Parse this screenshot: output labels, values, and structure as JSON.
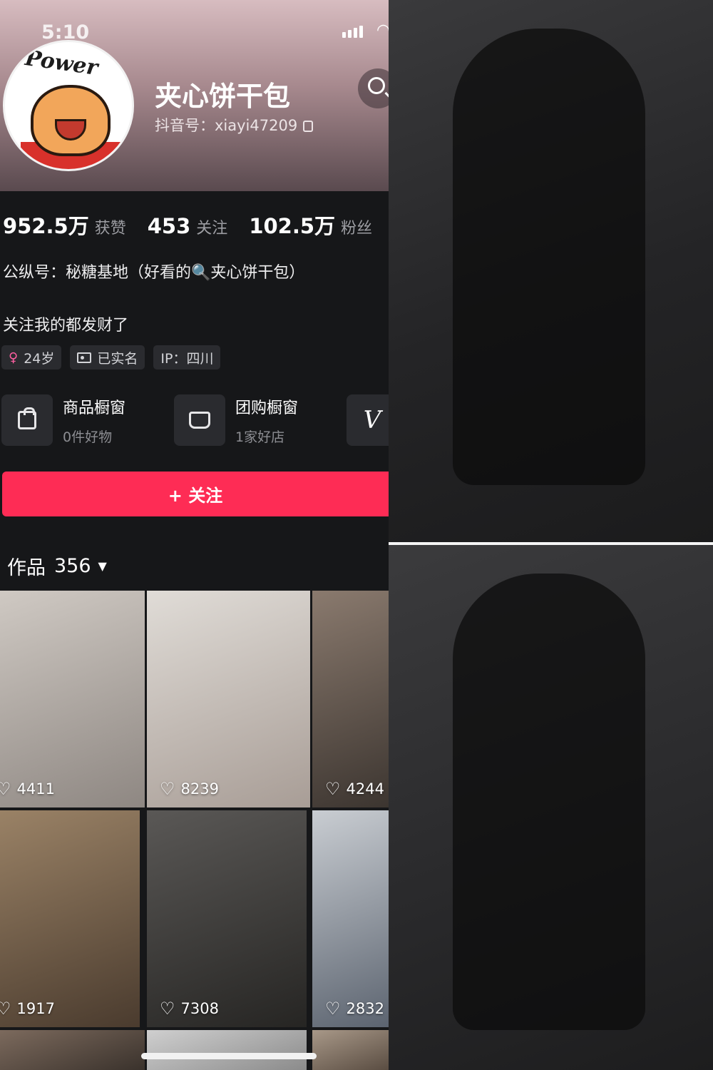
{
  "status_bar": {
    "time": "5:10"
  },
  "profile": {
    "name": "夹心饼干包",
    "douyin_id": "抖音号：xiayi47209",
    "avatar_text": "Power"
  },
  "stats": [
    {
      "value": "952.5万",
      "label": "获赞"
    },
    {
      "value": "453",
      "label": "关注"
    },
    {
      "value": "102.5万",
      "label": "粉丝"
    }
  ],
  "bio": {
    "line1": "公纵号：秘糖基地（好看的🔍夹心饼干包）",
    "line2": "关注我的都发财了"
  },
  "tags": {
    "age": "24岁",
    "verified": "已实名",
    "ip": "IP：四川"
  },
  "shops": [
    {
      "title": "商品橱窗",
      "subtitle": "0件好物",
      "icon": "shopping-bag-icon"
    },
    {
      "title": "团购橱窗",
      "subtitle": "1家好店",
      "icon": "store-icon"
    }
  ],
  "shop_extra_icon_text": "V",
  "follow_button": "+ 关注",
  "works": {
    "label": "作品",
    "count": "356"
  },
  "videos": [
    {
      "likes": "4411"
    },
    {
      "likes": "8239"
    },
    {
      "likes": "4244"
    },
    {
      "likes": "1917"
    },
    {
      "likes": "7308"
    },
    {
      "likes": "2832"
    }
  ],
  "colors": {
    "accent": "#fe2c55",
    "background": "#161719",
    "chip": "#2a2b2f",
    "muted_text": "#9d9ea3"
  }
}
